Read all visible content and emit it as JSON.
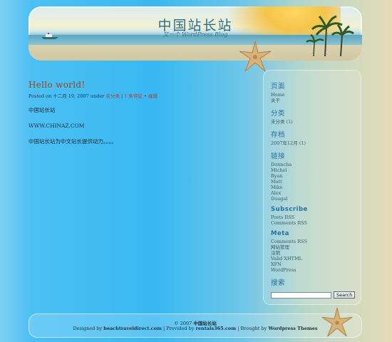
{
  "header": {
    "title": "中国站长站",
    "description": "又一个 WordPress Blog"
  },
  "post": {
    "title": "Hello world!",
    "meta_prefix": "Posted on 十二月 19, 2007 under",
    "meta_category": "未分类",
    "meta_separator": "|",
    "meta_comments": "1 条评论",
    "meta_bullet": "•",
    "meta_edit": "编辑",
    "lines": [
      "中国站长站",
      "WWW.CHINAZ.COM",
      "中国站长站为中文站长提供动力。。。。"
    ]
  },
  "sidebar": {
    "pages": {
      "title": "页面",
      "items": [
        "Home",
        "关于"
      ]
    },
    "categories": {
      "title": "分类",
      "items": [
        "未分类 (1)"
      ]
    },
    "archives": {
      "title": "存档",
      "items": [
        "2007年12月 (1)"
      ]
    },
    "links": {
      "title": "链接",
      "items": [
        "Donncha",
        "Michel",
        "Ryan",
        "Matt",
        "Mike",
        "Alex",
        "Dougal"
      ]
    },
    "subscribe": {
      "title": "Subscribe",
      "items": [
        "Posts RSS",
        "Comments RSS"
      ]
    },
    "meta": {
      "title": "Meta",
      "items": [
        "Comments RSS",
        "网站管理",
        "注销",
        "Valid XHTML",
        "XFN",
        "WordPress"
      ]
    },
    "search": {
      "title": "搜索",
      "value": "",
      "button": "Search"
    }
  },
  "footer": {
    "copyright_prefix": "© 2007",
    "copyright_site": "中国站长站",
    "designed_by": "Designed by",
    "designer": "beachtraveldirect.com",
    "provided_by": "| Provided by",
    "provider": "rentals365.com",
    "brought_by": "| Brought by",
    "themes": "Wordpress Themes"
  },
  "colors": {
    "accent": "#2c6f9b",
    "post_title": "#8a4a2a",
    "link_red": "#b23a3a"
  }
}
